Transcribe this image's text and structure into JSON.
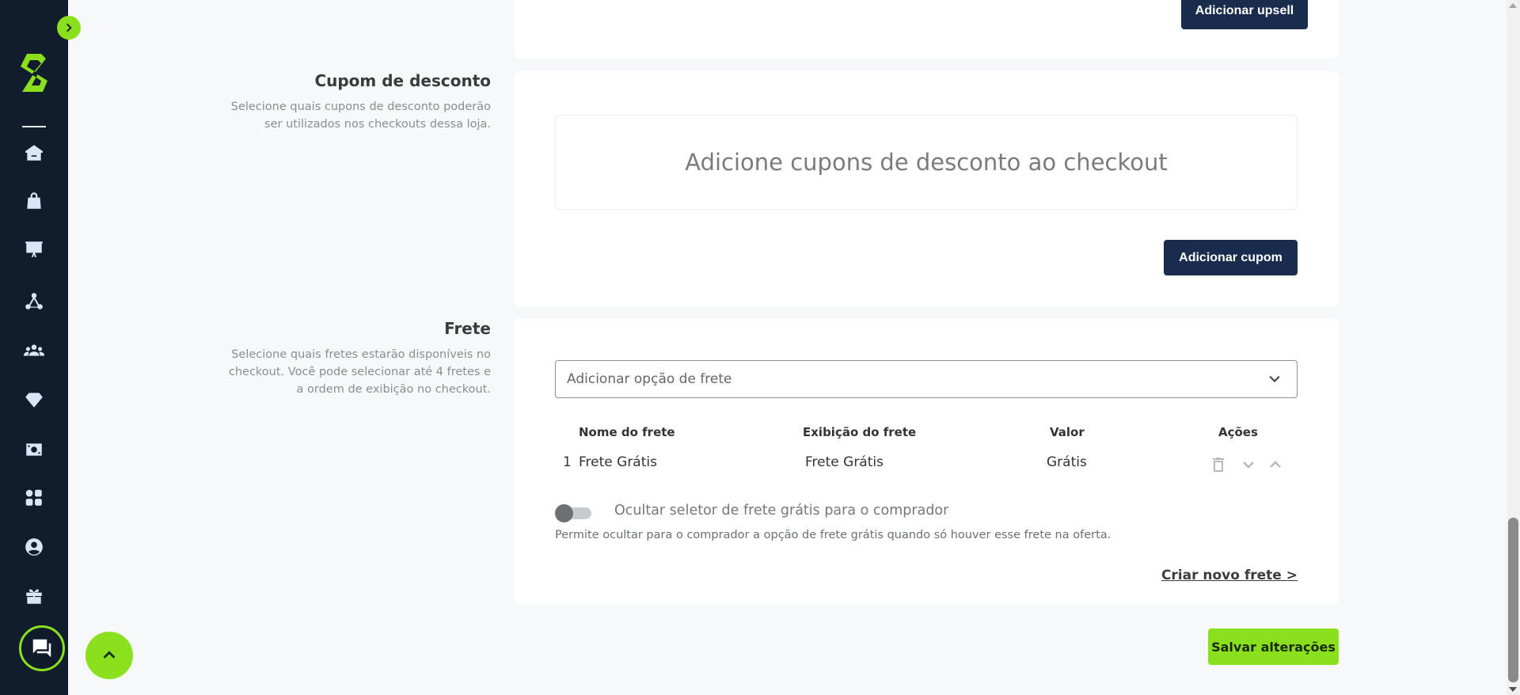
{
  "colors": {
    "sidebar": "#111d2d",
    "accent": "#8be01e",
    "navy_button": "#192c4d"
  },
  "sidebar": {
    "icons": [
      "home-icon",
      "bag-icon",
      "presentation-chart-icon",
      "network-icon",
      "users-icon",
      "diamond-icon",
      "money-icon",
      "apps-icon",
      "account-icon",
      "gift-icon"
    ]
  },
  "upsell": {
    "add_button": "Adicionar upsell"
  },
  "coupon": {
    "title": "Cupom de desconto",
    "description": "Selecione quais cupons de desconto poderão ser utilizados nos checkouts dessa loja.",
    "empty_text": "Adicione cupons de desconto ao checkout",
    "add_button": "Adicionar cupom"
  },
  "shipping": {
    "title": "Frete",
    "description": "Selecione quais fretes estarão disponíveis no checkout. Você pode selecionar até 4 fretes e a ordem de exibição no checkout.",
    "select_placeholder": "Adicionar opção de frete",
    "columns": {
      "name": "Nome do frete",
      "display": "Exibição do frete",
      "value": "Valor",
      "actions": "Ações"
    },
    "rows": [
      {
        "index": "1",
        "name": "Frete Grátis",
        "display": "Frete Grátis",
        "value": "Grátis"
      }
    ],
    "toggle_label": "Ocultar seletor de frete grátis para o comprador",
    "toggle_on": false,
    "toggle_help": "Permite ocultar para o comprador a opção de frete grátis quando só houver esse frete na oferta.",
    "create_link": "Criar novo frete >"
  },
  "save_button": "Salvar alterações"
}
